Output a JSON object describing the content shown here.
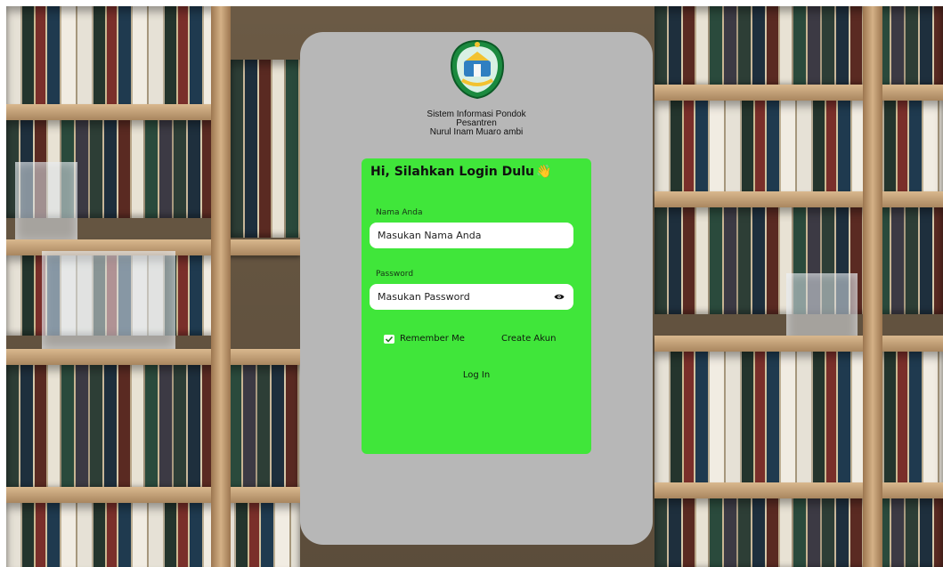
{
  "app": {
    "subtitle_lines": [
      "Sistem Informasi Pondok",
      "Pesantren",
      "Nurul Inam Muaro ambi"
    ]
  },
  "login": {
    "greeting": "Hi, Silahkan Login Dulu",
    "greeting_emoji": "👋",
    "name_label": "Nama Anda",
    "name_placeholder": "Masukan Nama Anda",
    "password_label": "Password",
    "password_placeholder": "Masukan Password",
    "remember_label": "Remember Me",
    "remember_checked": true,
    "create_account_label": "Create Akun",
    "login_button_label": "Log In"
  },
  "icons": {
    "logo": "institution-logo",
    "password_toggle": "eye-icon",
    "remember_checkbox": "checkbox-checked-icon"
  },
  "colors": {
    "card": "#b7b7b7",
    "panel": "#40e63a",
    "input_bg": "#ffffff",
    "text": "#101010"
  }
}
